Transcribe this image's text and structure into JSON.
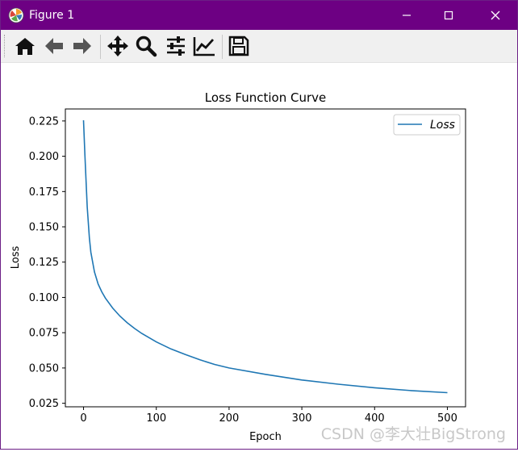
{
  "window": {
    "title": "Figure 1",
    "title_bar_color": "#6d0083",
    "controls": [
      "minimize-icon",
      "maximize-icon",
      "close-icon"
    ]
  },
  "toolbar": {
    "tools": [
      {
        "name": "home",
        "icon": "home-icon"
      },
      {
        "name": "back",
        "icon": "arrow-left-icon"
      },
      {
        "name": "forward",
        "icon": "arrow-right-icon"
      },
      {
        "name": "pan",
        "icon": "move-icon"
      },
      {
        "name": "zoom",
        "icon": "magnifier-icon"
      },
      {
        "name": "subplots",
        "icon": "sliders-icon"
      },
      {
        "name": "customize",
        "icon": "line-chart-icon"
      },
      {
        "name": "save",
        "icon": "floppy-disk-icon"
      }
    ]
  },
  "chart_data": {
    "type": "line",
    "title": "Loss Function Curve",
    "xlabel": "Epoch",
    "ylabel": "Loss",
    "xlim": [
      -25,
      525
    ],
    "ylim": [
      0.0225,
      0.2335
    ],
    "xticks": [
      0,
      100,
      200,
      300,
      400,
      500
    ],
    "yticks": [
      0.025,
      0.05,
      0.075,
      0.1,
      0.125,
      0.15,
      0.175,
      0.2,
      0.225
    ],
    "xtick_labels": [
      "0",
      "100",
      "200",
      "300",
      "400",
      "500"
    ],
    "ytick_labels": [
      "0.025",
      "0.050",
      "0.075",
      "0.100",
      "0.125",
      "0.150",
      "0.175",
      "0.200",
      "0.225"
    ],
    "grid": false,
    "legend_position": "upper right",
    "series": [
      {
        "name": "Loss",
        "color": "#1f77b4",
        "x": [
          0,
          2,
          5,
          8,
          10,
          15,
          20,
          25,
          30,
          40,
          50,
          60,
          70,
          80,
          100,
          120,
          140,
          160,
          180,
          200,
          250,
          300,
          350,
          400,
          450,
          500
        ],
        "y": [
          0.2255,
          0.2,
          0.164,
          0.142,
          0.132,
          0.118,
          0.1095,
          0.104,
          0.0995,
          0.0925,
          0.0868,
          0.082,
          0.078,
          0.0745,
          0.0685,
          0.0635,
          0.0595,
          0.0558,
          0.0525,
          0.05,
          0.0455,
          0.0415,
          0.0385,
          0.036,
          0.034,
          0.0325
        ]
      }
    ]
  },
  "watermark": "CSDN @李大壮BigStrong"
}
